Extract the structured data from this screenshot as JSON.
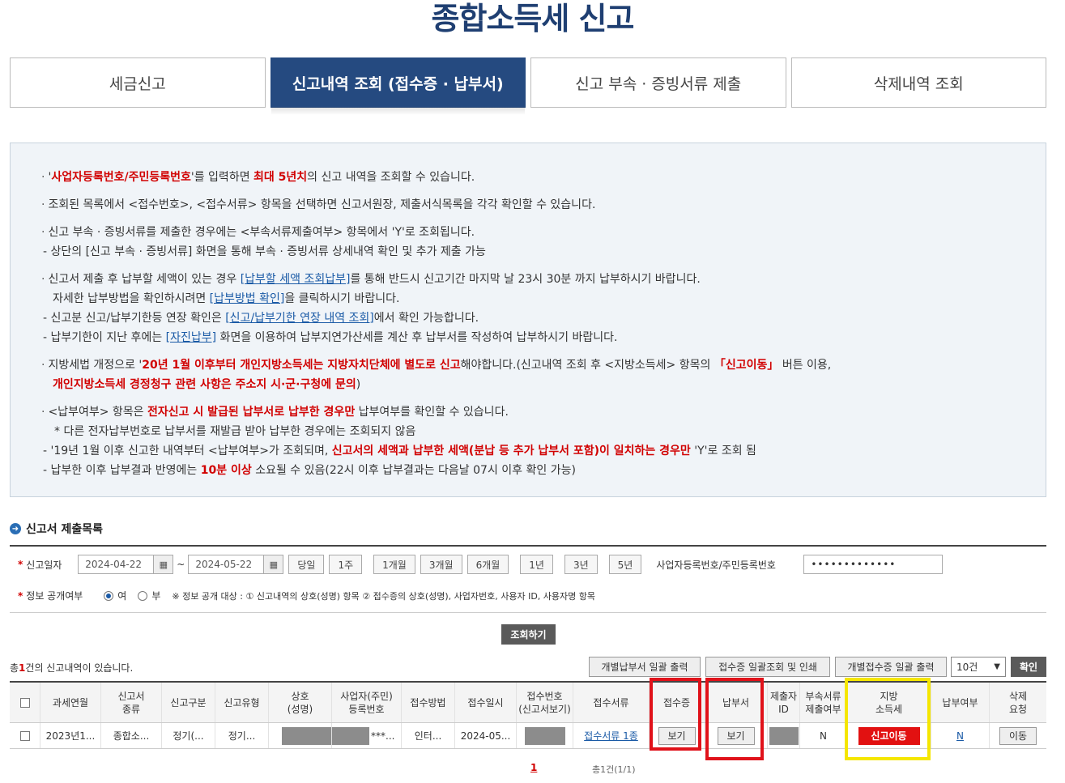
{
  "page": {
    "title": "종합소득세 신고"
  },
  "tabs": [
    {
      "label": "세금신고",
      "active": false
    },
    {
      "label": "신고내역 조회 (접수증 · 납부서)",
      "active": true
    },
    {
      "label": "신고 부속 · 증빙서류 제출",
      "active": false
    },
    {
      "label": "삭제내역 조회",
      "active": false
    }
  ],
  "notice": {
    "n1": {
      "q1": "'",
      "red": "사업자등록번호/주민등록번호",
      "a": "'를 입력하면 ",
      "red2": "최대 5년치",
      "b": "의 신고 내역을 조회할 수 있습니다."
    },
    "n2": "조회된 목록에서 <접수번호>, <접수서류> 항목을 선택하면 신고서원장, 제출서식목록을 각각 확인할 수 있습니다.",
    "n3a": "신고 부속 · 증빙서류를 제출한 경우에는 <부속서류제출여부> 항목에서 'Y'로 조회됩니다.",
    "n3b": "- 상단의 [신고 부속 · 증빙서류] 화면을 통해 부속 · 증빙서류 상세내역 확인 및 추가 제출 가능",
    "n4a": {
      "a": "신고서 제출 후 납부할 세액이 있는 경우 ",
      "link": "[납부할 세액 조회납부]",
      "b": "를 통해 반드시 신고기간 마지막 날 23시 30분 까지 납부하시기 바랍니다."
    },
    "n4b": {
      "a": "자세한 납부방법을 확인하시려면 ",
      "link": "[납부방법 확인]",
      "b": "을 클릭하시기 바랍니다."
    },
    "n4c": {
      "a": "- 신고분 신고/납부기한등 연장 확인은 ",
      "link": "[신고/납부기한 연장 내역 조회]",
      "b": "에서 확인 가능합니다."
    },
    "n4d": {
      "a": "- 납부기한이 지난 후에는 ",
      "link": "[자진납부]",
      "b": " 화면을 이용하여 납부지연가산세를 계산 후 납부서를 작성하여 납부하시기 바랍니다."
    },
    "n5a": {
      "a": "지방세법 개정으로 '",
      "red": "20년 1월 이후부터 개인지방소득세는 지방자치단체에 별도로 신고",
      "b": "해야합니다.(신고내역 조회 후 <지방소득세> 항목의 ",
      "red2": "「신고이동」",
      "c": " 버튼 이용,"
    },
    "n5b": {
      "red": "개인지방소득세 경정청구 관련 사항은 주소지 시·군·구청에 문의",
      "b": ")"
    },
    "n6a": {
      "a": "<납부여부> 항목은 ",
      "red": "전자신고 시 발급된 납부서로 납부한 경우만",
      "b": " 납부여부를 확인할 수 있습니다."
    },
    "n6b": "* 다른 전자납부번호로 납부서를 재발급 받아 납부한 경우에는 조회되지 않음",
    "n6c": {
      "a": "- '19년 1월 이후 신고한 내역부터 <납부여부>가 조회되며, ",
      "red": "신고서의 세액과 납부한 세액(분납 등 추가 납부서 포함)이 일치하는 경우만",
      "b": " 'Y'로 조회 됨"
    },
    "n6d": {
      "a": "- 납부한 이후 납부결과 반영에는 ",
      "red": "10분 이상",
      "b": " 소요될 수 있음(22시 이후 납부결과는 다음날 07시 이후 확인 가능)"
    }
  },
  "section": {
    "title": "신고서 제출목록",
    "icon": "arrow-circle-icon"
  },
  "search": {
    "date_label": "신고일자",
    "date_from": "2024-04-22",
    "date_to": "2024-05-22",
    "tilde": "~",
    "periods": [
      "당일",
      "1주",
      "1개월",
      "3개월",
      "6개월",
      "1년",
      "3년",
      "5년"
    ],
    "id_label": "사업자등록번호/주민등록번호",
    "id_value": "•••••••••••••",
    "disclose_label": "정보 공개여부",
    "yes": "여",
    "no": "부",
    "disclose_note": "※ 정보 공개 대상 : ① 신고내역의 상호(성명) 항목 ② 접수증의 상호(성명), 사업자번호, 사용자 ID, 사용자명 항목",
    "query_button": "조회하기"
  },
  "results": {
    "count_prefix": "총",
    "count": "1",
    "count_suffix": "건의 신고내역이 있습니다.",
    "btn_print_payment": "개별납부서 일괄 출력",
    "btn_receipt_print": "접수증 일괄조회 및 인쇄",
    "btn_receipt_bulk": "개별접수증 일괄 출력",
    "page_size": "10건",
    "ok": "확인"
  },
  "table": {
    "headers": {
      "period": "과세연월",
      "type1": "신고서",
      "type2": "종류",
      "div": "신고구분",
      "kind": "신고유형",
      "name1": "상호",
      "name2": "(성명)",
      "reg1": "사업자(주민)",
      "reg2": "등록번호",
      "method": "접수방법",
      "date": "접수일시",
      "recno1": "접수번호",
      "recno2": "(신고서보기)",
      "docs": "접수서류",
      "receipt": "접수증",
      "payment": "납부서",
      "sub1": "제출자",
      "sub2": "ID",
      "att1": "부속서류",
      "att2": "제출여부",
      "local1": "지방",
      "local2": "소득세",
      "paid": "납부여부",
      "del1": "삭제",
      "del2": "요청"
    },
    "row": {
      "period": "2023년1...",
      "type": "종합소...",
      "div": "정기(...",
      "kind": "정기...",
      "reg": "***...",
      "method": "인터...",
      "date": "2024-05...",
      "docs": "접수서류 1종",
      "receipt": "보기",
      "payment": "보기",
      "attach": "N",
      "local": "신고이동",
      "paid": "N",
      "del": "이동"
    }
  },
  "pagination": {
    "current": "1",
    "total": "총1건(1/1)"
  },
  "highlights": {
    "red": "#e0121a",
    "yellow": "#f5e600"
  }
}
